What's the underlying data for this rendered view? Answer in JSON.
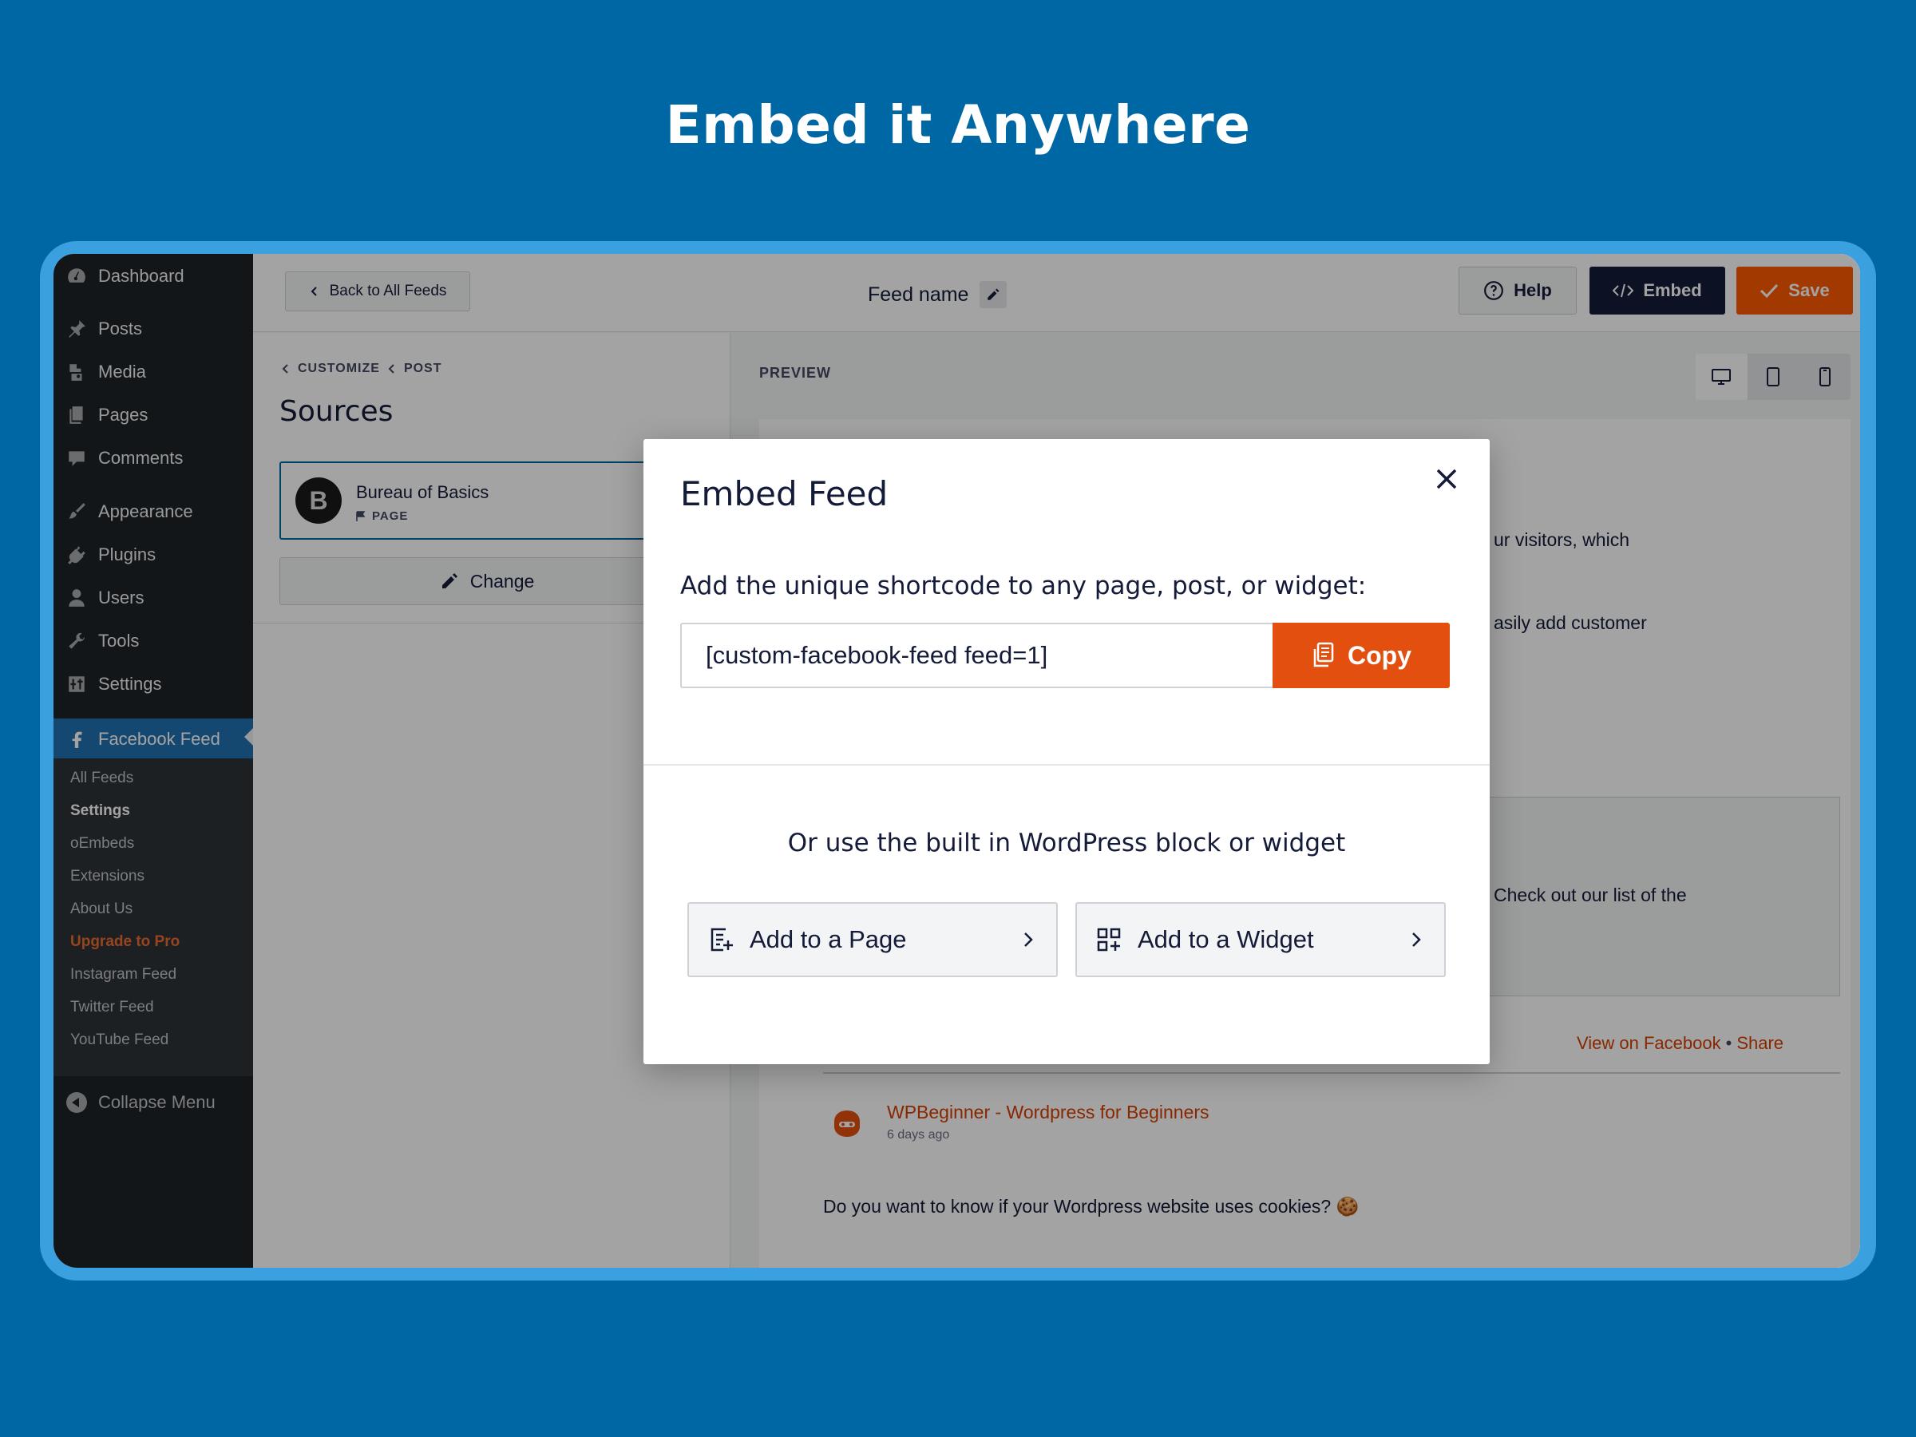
{
  "hero": {
    "title": "Embed it Anywhere"
  },
  "wp_menu": {
    "items": [
      {
        "label": "Dashboard",
        "icon": "dashboard-icon"
      },
      {
        "label": "Posts",
        "icon": "pin-icon"
      },
      {
        "label": "Media",
        "icon": "media-icon"
      },
      {
        "label": "Pages",
        "icon": "pages-icon"
      },
      {
        "label": "Comments",
        "icon": "comment-icon"
      },
      {
        "label": "Appearance",
        "icon": "brush-icon"
      },
      {
        "label": "Plugins",
        "icon": "plug-icon"
      },
      {
        "label": "Users",
        "icon": "user-icon"
      },
      {
        "label": "Tools",
        "icon": "wrench-icon"
      },
      {
        "label": "Settings",
        "icon": "sliders-icon"
      }
    ],
    "active": {
      "label": "Facebook Feed",
      "icon": "facebook-icon"
    },
    "submenu": [
      "All Feeds",
      "Settings",
      "oEmbeds",
      "Extensions",
      "About Us",
      "Upgrade to Pro",
      "Instagram Feed",
      "Twitter Feed",
      "YouTube Feed"
    ],
    "collapse_label": "Collapse Menu"
  },
  "topbar": {
    "back_label": "Back to All Feeds",
    "feed_name": "Feed name",
    "help_label": "Help",
    "embed_label": "Embed",
    "save_label": "Save"
  },
  "left_panel": {
    "crumb_customize": "CUSTOMIZE",
    "crumb_post": "POST",
    "title": "Sources",
    "source_name": "Bureau of Basics",
    "source_initial": "B",
    "source_type": "PAGE",
    "change_label": "Change"
  },
  "preview": {
    "label": "PREVIEW",
    "text_line_1": "ur visitors, which",
    "text_line_2": "asily add customer",
    "quote_text": "Check out our list of the",
    "view_on_facebook": "View on Facebook",
    "separator": "•",
    "share": "Share",
    "post_author": "WPBeginner - Wordpress for Beginners",
    "post_time": "6 days ago",
    "post_text": "Do you want to know if your Wordpress website uses cookies? 🍪"
  },
  "modal": {
    "title": "Embed Feed",
    "subtitle": "Add the unique shortcode to any page, post, or widget:",
    "shortcode": "[custom-facebook-feed feed=1]",
    "copy_label": "Copy",
    "alt_text": "Or use the built in WordPress block or widget",
    "add_page_label": "Add to a Page",
    "add_widget_label": "Add to a Widget"
  },
  "colors": {
    "page_bg": "#0067a5",
    "frame": "#3aa0df",
    "wp_sidebar": "#1d2327",
    "wp_active": "#2271b1",
    "accent_orange": "#e34f0e",
    "dark_navy": "#141b38"
  }
}
